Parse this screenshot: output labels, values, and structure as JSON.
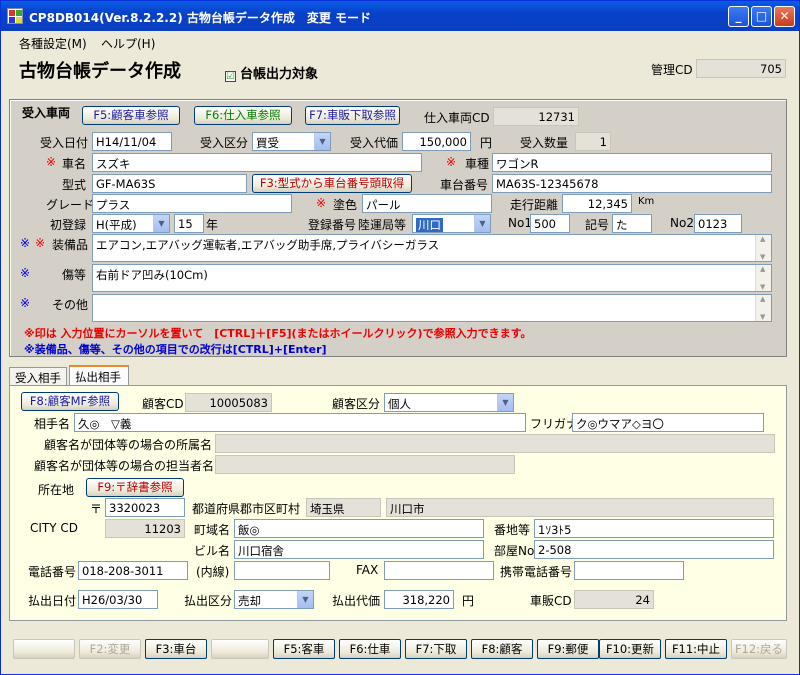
{
  "window": {
    "title": "CP8DB014(Ver.8.2.2.2) 古物台帳データ作成　変更 モード"
  },
  "menu": {
    "settings": "各種設定(M)",
    "help": "ヘルプ(H)"
  },
  "header": {
    "page_title": "古物台帳データ作成",
    "ledger_checkbox_label": "台帳出力対象",
    "ledger_checked": "☑",
    "mgmt_cd_label": "管理CD",
    "mgmt_cd_value": "705"
  },
  "vehicle": {
    "section_label": "受入車両",
    "btn_f5": "F5:顧客車参照",
    "btn_f6": "F6:仕入車参照",
    "btn_f7": "F7:車販下取参照",
    "purchase_cd_label": "仕入車両CD",
    "purchase_cd_value": "12731",
    "date_label": "受入日付",
    "date_value": "H14/11/04",
    "type_label": "受入区分",
    "type_value": "買受",
    "price_label": "受入代価",
    "price_value": "150,000",
    "price_unit": "円",
    "qty_label": "受入数量",
    "qty_value": "1",
    "required_mark": "※",
    "maker_label": "車名",
    "maker_value": "スズキ",
    "body_label": "車種",
    "body_value": "ワゴンR",
    "model_label": "型式",
    "model_value": "GF-MA63S",
    "btn_f3": "F3:型式から車台番号頭取得",
    "chassis_label": "車台番号",
    "chassis_value": "MA63S-12345678",
    "grade_label": "グレード",
    "grade_value": "プラス",
    "color_label": "塗色",
    "color_value": "パール",
    "mileage_label": "走行距離",
    "mileage_value": "12,345",
    "mileage_unit": "Km",
    "first_reg_label": "初登録",
    "era_value": "H(平成)",
    "year_value": "15",
    "year_unit": "年",
    "reg_no_label": "登録番号",
    "reg_office_value": "陸運局等",
    "reg_select_value": "川口",
    "no1_label": "No1",
    "no1_value": "500",
    "kigo_label": "記号",
    "kigo_value": "た",
    "no2_label": "No2",
    "no2_value": "0123",
    "equip_label": "装備品",
    "equip_value": "エアコン,エアバッグ運転者,エアバッグ助手席,プライバシーガラス",
    "damage_label": "傷等",
    "damage_value": "右前ドア凹み(10Cm)",
    "other_label": "その他",
    "other_value": "",
    "note1": "※印は 入力位置にカーソルを置いて　[CTRL]＋[F5](またはホイールクリック)で参照入力できます。",
    "note2": "※装備品、傷等、その他の項目での改行は[CTRL]+[Enter]"
  },
  "tabs": {
    "receive": "受入相手",
    "payout": "払出相手"
  },
  "customer": {
    "btn_f8": "F8:顧客MF参照",
    "cd_label": "顧客CD",
    "cd_value": "10005083",
    "kubun_label": "顧客区分",
    "kubun_value": "個人",
    "name_label": "相手名",
    "name_value": "久◎　▽義",
    "kana_label": "フリガナ",
    "kana_value": "ク◎ウマア◇ヨ〇",
    "org_label": "顧客名が団体等の場合の所属名",
    "contact_label": "顧客名が団体等の場合の担当者名",
    "address_label": "所在地",
    "btn_f9": "F9:〒辞書参照",
    "zip_mark": "〒",
    "zip_value": "3320023",
    "pref_label": "都道府県郡市区町村",
    "pref_value": "埼玉県",
    "city_value": "川口市",
    "citycd_label": "CITY CD",
    "citycd_value": "11203",
    "town_label": "町域名",
    "town_value": "飯◎",
    "banchi_label": "番地等",
    "banchi_value": "1ｿ3ﾄ5",
    "bldg_label": "ビル名",
    "bldg_value": "川口宿舎",
    "room_label": "部屋No",
    "room_value": "2-508",
    "tel_label": "電話番号",
    "tel_value": "018-208-3011",
    "naisen_label": "(内線)",
    "fax_label": "FAX",
    "mobile_label": "携帯電話番号",
    "pay_date_label": "払出日付",
    "pay_date_value": "H26/03/30",
    "pay_kubun_label": "払出区分",
    "pay_kubun_value": "売却",
    "pay_price_label": "払出代価",
    "pay_price_value": "318,220",
    "pay_unit": "円",
    "sale_cd_label": "車販CD",
    "sale_cd_value": "24"
  },
  "fkeys": {
    "f2": "F2:変更",
    "f3": "F3:車台",
    "f5": "F5:客車",
    "f6": "F6:仕車",
    "f7": "F7:下取",
    "f8": "F8:顧客",
    "f9": "F9:郵便",
    "f10": "F10:更新",
    "f11": "F11:中止",
    "f12": "F12:戻る"
  }
}
